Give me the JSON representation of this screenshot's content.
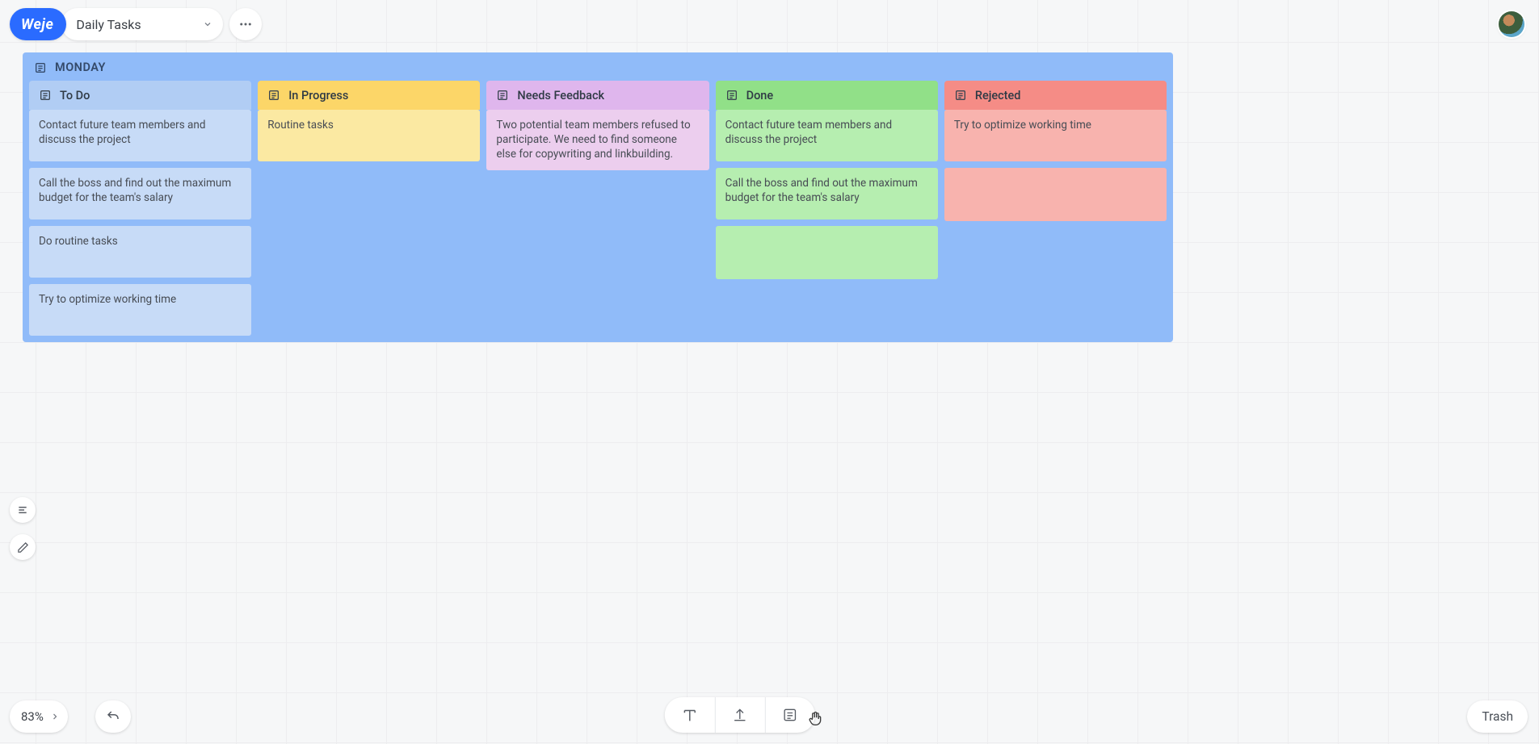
{
  "app": {
    "logo": "Weje",
    "board_name": "Daily Tasks"
  },
  "board": {
    "title": "MONDAY",
    "columns": [
      {
        "id": "todo",
        "label": "To Do",
        "header_class": "th-blue-h",
        "card_class": "th-blue-c",
        "cards": [
          "Contact future team members and discuss the project",
          "Call the boss and find out the maximum budget for the team's salary",
          "Do routine tasks",
          "Try to optimize working time"
        ]
      },
      {
        "id": "inprogress",
        "label": "In Progress",
        "header_class": "th-yellow-h",
        "card_class": "th-yellow-c",
        "cards": [
          "Routine tasks"
        ]
      },
      {
        "id": "feedback",
        "label": "Needs Feedback",
        "header_class": "th-purple-h",
        "card_class": "th-purple-c",
        "cards": [
          "Two potential team members refused to participate. We need to find someone else for copywriting and linkbuilding."
        ]
      },
      {
        "id": "done",
        "label": "Done",
        "header_class": "th-green-h",
        "card_class": "th-green-c",
        "cards": [
          "Contact future team members and discuss the project",
          "Call the boss and find out the maximum budget for the team's salary",
          ""
        ]
      },
      {
        "id": "rejected",
        "label": "Rejected",
        "header_class": "th-red-h",
        "card_class": "th-red-c",
        "cards": [
          "Try to optimize working time",
          ""
        ]
      }
    ]
  },
  "zoom": "83%",
  "trash": "Trash"
}
